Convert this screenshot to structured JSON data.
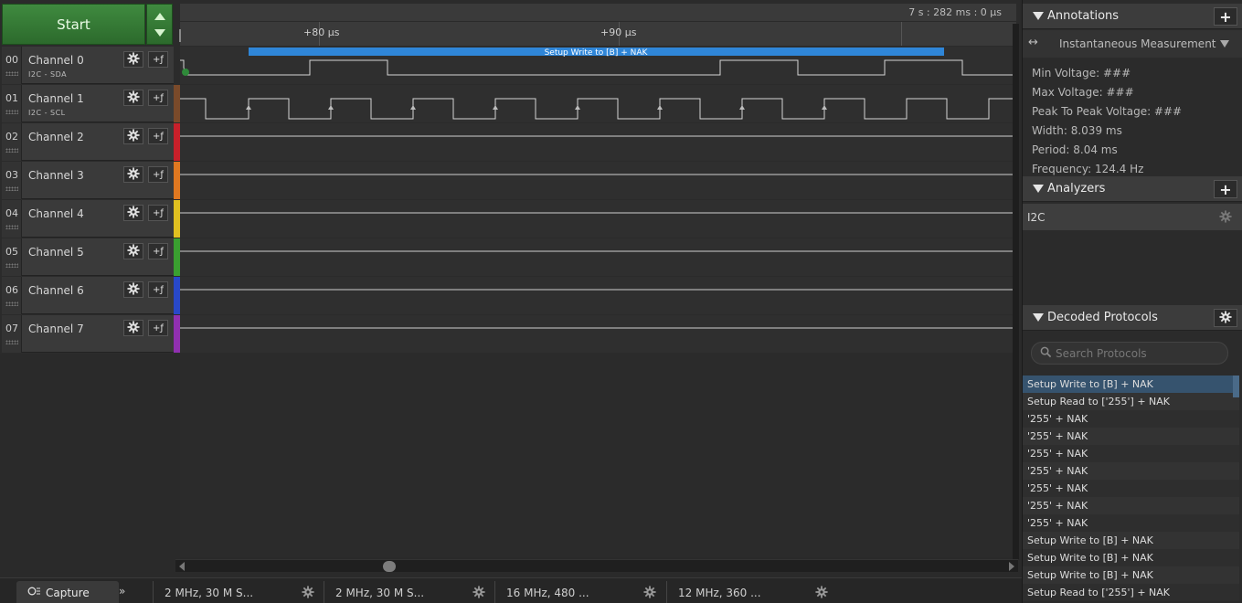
{
  "start_button": {
    "label": "Start"
  },
  "timeline": {
    "absolute_time": "7 s : 282 ms : 0 µs",
    "ticks": [
      "+80 µs",
      "+90 µs"
    ],
    "decode_bubble": "Setup Write to [B] + NAK"
  },
  "channels": [
    {
      "num": "00",
      "name": "Channel 0",
      "sub": "I2C - SDA",
      "color": "#2b2b2b"
    },
    {
      "num": "01",
      "name": "Channel 1",
      "sub": "I2C - SCL",
      "color": "#7a4a2a"
    },
    {
      "num": "02",
      "name": "Channel 2",
      "sub": "",
      "color": "#c8202a"
    },
    {
      "num": "03",
      "name": "Channel 3",
      "sub": "",
      "color": "#e07820"
    },
    {
      "num": "04",
      "name": "Channel 4",
      "sub": "",
      "color": "#e0c020"
    },
    {
      "num": "05",
      "name": "Channel 5",
      "sub": "",
      "color": "#3aa030"
    },
    {
      "num": "06",
      "name": "Channel 6",
      "sub": "",
      "color": "#2848c8"
    },
    {
      "num": "07",
      "name": "Channel 7",
      "sub": "",
      "color": "#9030b0"
    }
  ],
  "annotations": {
    "title": "Annotations",
    "measurement_select": "Instantaneous Measurement",
    "lines": [
      "Min Voltage: ###",
      "Max Voltage: ###",
      "Peak To Peak Voltage: ###",
      "Width: 8.039 ms",
      "Period: 8.04 ms",
      "Frequency: 124.4 Hz"
    ]
  },
  "analyzers": {
    "title": "Analyzers",
    "items": [
      "I2C"
    ]
  },
  "decoded": {
    "title": "Decoded Protocols",
    "search_placeholder": "Search Protocols",
    "items": [
      "Setup Write to [B] + NAK",
      "Setup Read to ['255'] + NAK",
      "'255' + NAK",
      "'255' + NAK",
      "'255' + NAK",
      "'255' + NAK",
      "'255' + NAK",
      "'255' + NAK",
      "'255' + NAK",
      "Setup Write to [B] + NAK",
      "Setup Write to [B] + NAK",
      "Setup Write to [B] + NAK",
      "Setup Read to ['255'] + NAK"
    ]
  },
  "bottom_tabs": {
    "capture": "Capture",
    "sessions": [
      "2 MHz, 30 M S...",
      "2 MHz, 30 M S...",
      "16 MHz, 480 ...",
      "12 MHz, 360 ..."
    ]
  },
  "colors": {
    "start_green": "#3f8a3f",
    "decode_blue": "#2f86d8",
    "selected_row": "#36536e"
  }
}
